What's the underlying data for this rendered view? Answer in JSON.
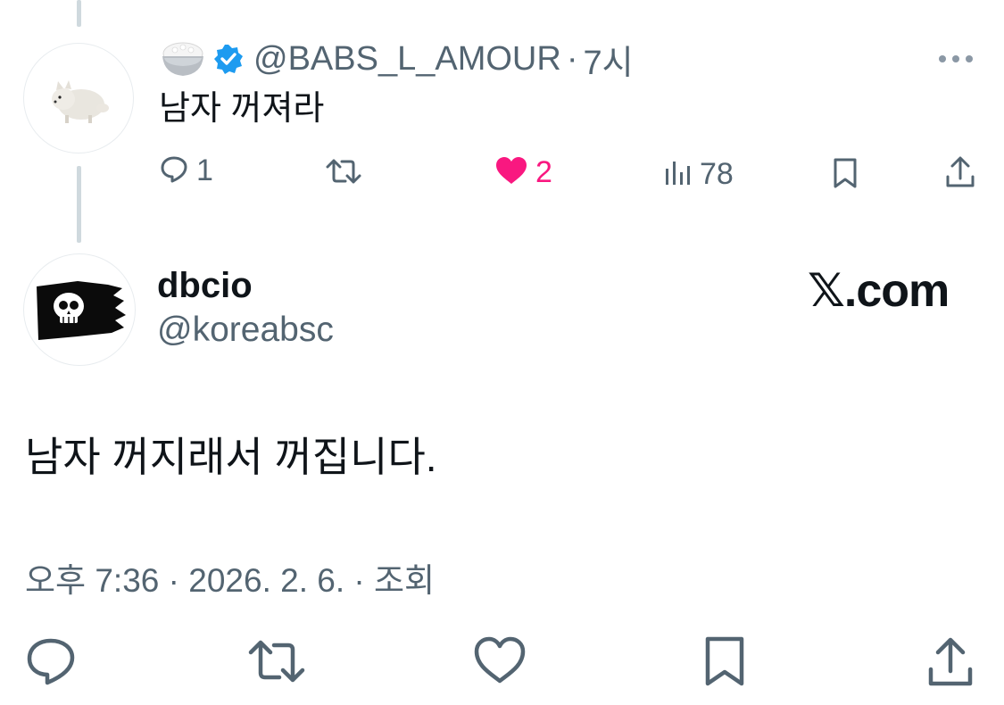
{
  "reply": {
    "username": "@BABS_L_AMOUR",
    "separator": "·",
    "time": "7시",
    "text": "남자 꺼져라",
    "actions": {
      "replies": "1",
      "likes": "2",
      "views": "78"
    }
  },
  "tweet": {
    "display_name": "dbcio",
    "handle": "@koreabsc",
    "brand": "𝕏.com",
    "text": "남자 꺼지래서 꺼집니다.",
    "meta": "오후 7:36 · 2026. 2. 6. · 조회"
  },
  "colors": {
    "like_pink": "#f91880",
    "verified_blue": "#1d9bf0",
    "muted_gray": "#536471",
    "thread_line": "#cfd9de"
  },
  "icons": [
    "rice-bowl-icon",
    "verified-badge-icon",
    "more-icon",
    "reply-icon",
    "retweet-icon",
    "heart-filled-icon",
    "views-icon",
    "bookmark-icon",
    "share-icon",
    "heart-outline-icon"
  ]
}
